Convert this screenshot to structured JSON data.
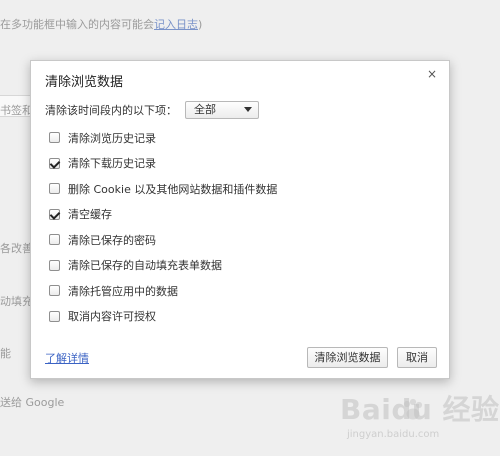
{
  "background": {
    "top_line_text": "在多功能框中输入的内容可能会",
    "top_line_link": "记入日志",
    "top_line_suffix": ")",
    "bookmark_fragment": "书签和",
    "address_fragment": "各改善",
    "autofill_fragment": "动填充",
    "power_fragment": "能",
    "google_fragment": "送给 Google"
  },
  "dialog": {
    "title": "清除浏览数据",
    "close_label": "×",
    "range_label": "清除该时间段内的以下项：",
    "range_selected": "全部",
    "options": [
      {
        "label": "清除浏览历史记录",
        "checked": false
      },
      {
        "label": "清除下载历史记录",
        "checked": true
      },
      {
        "label": "删除 Cookie 以及其他网站数据和插件数据",
        "checked": false
      },
      {
        "label": "清空缓存",
        "checked": true
      },
      {
        "label": "清除已保存的密码",
        "checked": false
      },
      {
        "label": "清除已保存的自动填充表单数据",
        "checked": false
      },
      {
        "label": "清除托管应用中的数据",
        "checked": false
      },
      {
        "label": "取消内容许可授权",
        "checked": false
      }
    ],
    "learn_more": "了解详情",
    "clear_button": "清除浏览数据",
    "cancel_button": "取消"
  },
  "watermark": {
    "main": "Baidu 经验",
    "sub": "jingyan.baidu.com"
  }
}
